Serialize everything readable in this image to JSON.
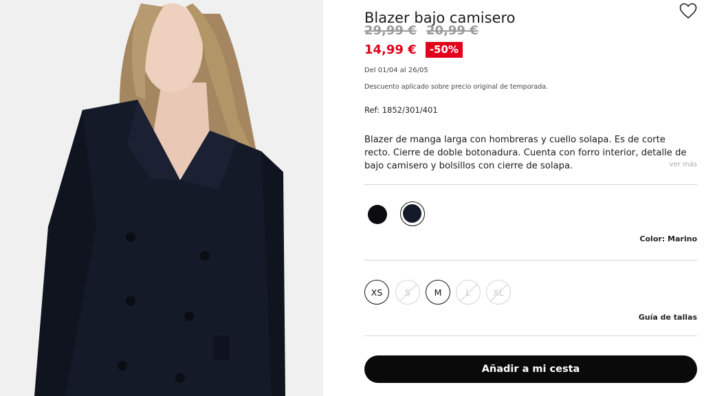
{
  "product": {
    "title": "Blazer bajo camisero",
    "old_prices": [
      "29,99 €",
      "20,99 €"
    ],
    "price": "14,99 €",
    "discount": "-50%",
    "dates": "Del 01/04 al 26/05",
    "discount_note": "Descuento aplicado sobre precio original de temporada.",
    "ref": "Ref: 1852/301/401",
    "description": "Blazer de manga larga con hombreras y cuello solapa. Es de corte recto. Cierre de doble botonadura. Cuenta con forro interior, detalle de bajo camisero y bolsillos con cierre de solapa.",
    "see_more": "ver más"
  },
  "colors": {
    "swatches": [
      {
        "name": "Negro",
        "hex": "#0c0c0f"
      },
      {
        "name": "Marino",
        "hex": "#151a2b",
        "selected": true
      }
    ],
    "label": "Color:",
    "selected": "Marino"
  },
  "sizes": [
    {
      "label": "XS",
      "available": true
    },
    {
      "label": "S",
      "available": false
    },
    {
      "label": "M",
      "available": true
    },
    {
      "label": "L",
      "available": false
    },
    {
      "label": "XL",
      "available": false
    }
  ],
  "size_guide": "Guía de tallas",
  "cta": "Añadir a mi cesta",
  "icons": {
    "favorite": "heart-icon"
  },
  "palette": {
    "sale_red": "#e3001b",
    "cta_black": "#0a0a0a"
  }
}
